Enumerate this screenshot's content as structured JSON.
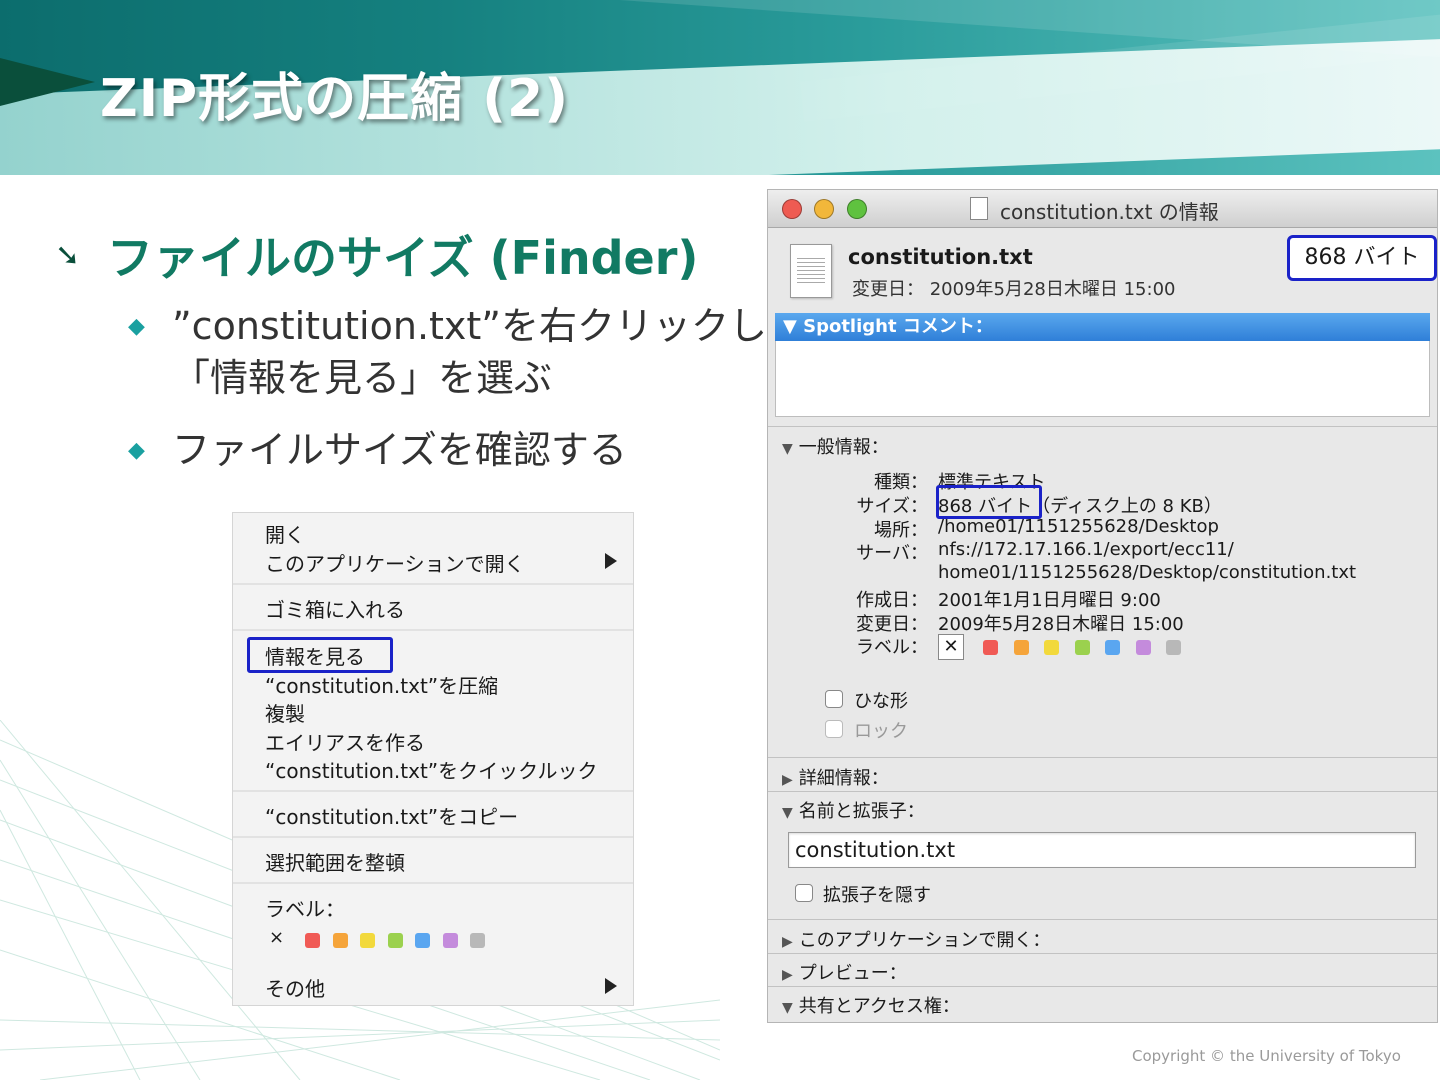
{
  "slide": {
    "title": "ZIP形式の圧縮 (2)",
    "bullet_main": "ファイルのサイズ (Finder)",
    "bullet_sub_1_line1": "”constitution.txt”を右クリックし，",
    "bullet_sub_1_line2": "「情報を見る」を選ぶ",
    "bullet_sub_2": "ファイルサイズを確認する",
    "copyright": "Copyright © the University of Tokyo"
  },
  "context_menu": {
    "open": "開く",
    "open_with": "このアプリケーションで開く",
    "trash": "ゴミ箱に入れる",
    "get_info": "情報を見る",
    "compress": "“constitution.txt”を圧縮",
    "duplicate": "複製",
    "make_alias": "エイリアスを作る",
    "quick_look": "“constitution.txt”をクイックルック",
    "copy": "“constitution.txt”をコピー",
    "clean_up": "選択範囲を整頓",
    "label": "ラベル：",
    "label_clear": "×",
    "other": "その他",
    "label_colors": [
      "#f05a55",
      "#f5a43a",
      "#f2d93c",
      "#9bd14e",
      "#5aa6f0",
      "#c48bdc",
      "#b8b8b8"
    ]
  },
  "info_window": {
    "title": "constitution.txt の情報",
    "file_name": "constitution.txt",
    "modified_summary": "変更日：  2009年5月28日木曜日 15:00",
    "size_badge": "868 バイト",
    "spotlight_header": "▼ Spotlight コメント：",
    "general_header": "一般情報：",
    "general": {
      "kind_key": "種類：",
      "kind_val": "標準テキスト",
      "size_key": "サイズ：",
      "size_val": "868 バイト",
      "size_disk": "（ディスク上の 8 KB）",
      "where_key": "場所：",
      "where_val": "/home01/1151255628/Desktop",
      "server_key": "サーバ：",
      "server_val_1": "nfs://172.17.166.1/export/ecc11/",
      "server_val_2": "home01/1151255628/Desktop/constitution.txt",
      "created_key": "作成日：",
      "created_val": "2001年1月1日月曜日 9:00",
      "modified_key": "変更日：",
      "modified_val": "2009年5月28日木曜日 15:00",
      "label_key": "ラベル：",
      "label_clear": "✕"
    },
    "stationery": "ひな形",
    "locked": "ロック",
    "more_info": "詳細情報：",
    "name_ext_header": "名前と拡張子：",
    "name_field_value": "constitution.txt",
    "hide_ext": "拡張子を隠す",
    "open_with": "このアプリケーションで開く：",
    "preview": "プレビュー：",
    "sharing": "共有とアクセス権：",
    "traffic_lights": [
      "#ee5b52",
      "#f2b73a",
      "#5fc23f"
    ]
  }
}
